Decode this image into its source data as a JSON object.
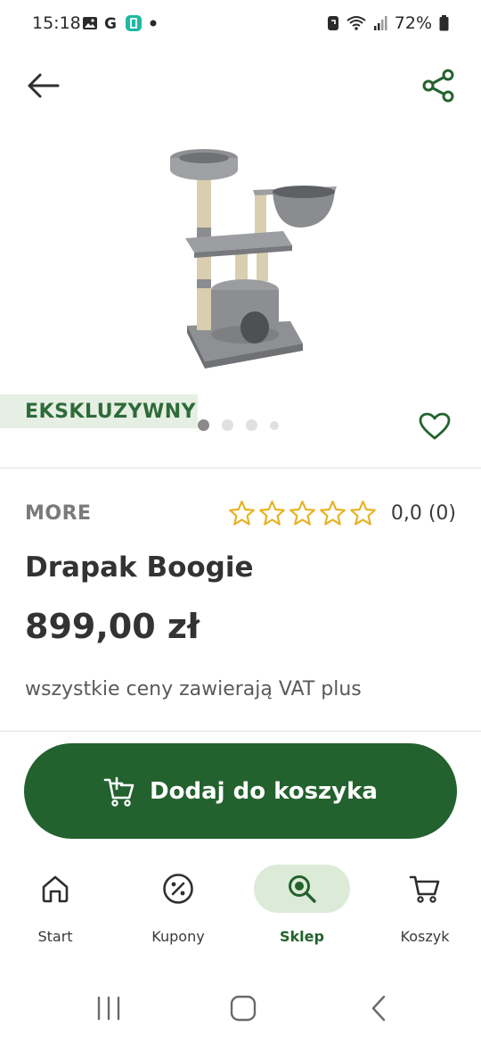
{
  "status_bar": {
    "time": "15:18",
    "battery": "72%",
    "left_icons": [
      "image-icon",
      "google-g-icon",
      "app-icon",
      "dot-icon"
    ],
    "right_icons": [
      "sync-icon",
      "wifi-icon",
      "signal-icon",
      "battery-icon"
    ]
  },
  "top_bar": {
    "back_icon": "arrow-left-icon",
    "share_icon": "share-icon"
  },
  "product": {
    "badge": "EKSKLUZYWNY",
    "image_count": 4,
    "active_image": 1,
    "brand": "MORE",
    "rating_value": "0,0 (0)",
    "stars_filled": 0,
    "stars_total": 5,
    "name": "Drapak Boogie",
    "price": "899,00 zł",
    "vat_note": "wszystkie ceny zawierają VAT plus"
  },
  "cta": {
    "add_to_cart_label": "Dodaj do koszyka"
  },
  "bottom_nav": {
    "items": [
      {
        "label": "Start",
        "icon": "home-icon",
        "active": false
      },
      {
        "label": "Kupony",
        "icon": "percent-icon",
        "active": false
      },
      {
        "label": "Sklep",
        "icon": "search-icon",
        "active": true
      },
      {
        "label": "Koszyk",
        "icon": "cart-icon",
        "active": false
      }
    ]
  },
  "colors": {
    "brand_green": "#23622e",
    "badge_bg": "#e6efe3",
    "nav_active_bg": "#dcebd8",
    "star_color": "#e7b325"
  }
}
